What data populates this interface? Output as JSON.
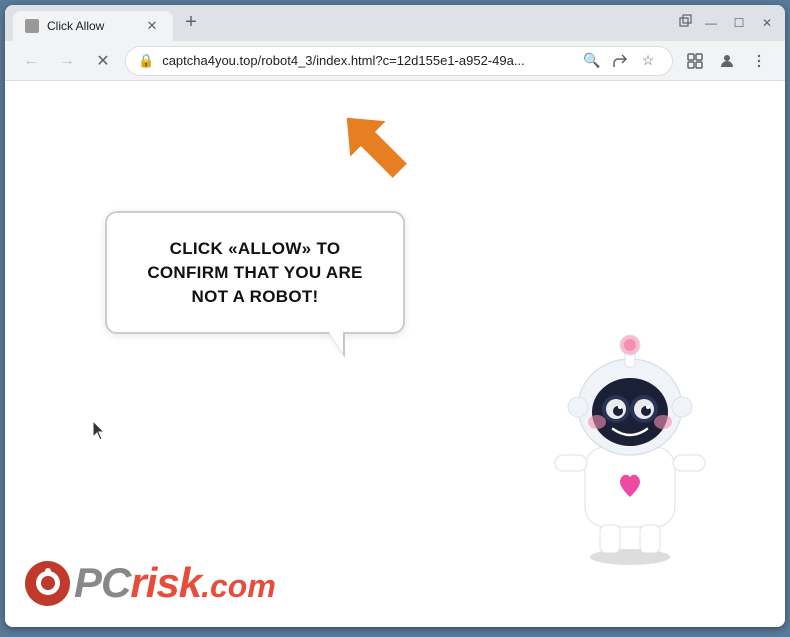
{
  "browser": {
    "tab": {
      "title": "Click Allow",
      "favicon_label": "tab-icon"
    },
    "new_tab_label": "+",
    "window_controls": {
      "minimize": "—",
      "maximize": "☐",
      "close": "✕"
    },
    "nav": {
      "back_label": "←",
      "forward_label": "→",
      "reload_label": "✕"
    },
    "url": "captcha4you.top/robot4_3/index.html?c=12d155e1-a952-49a...",
    "url_actions": {
      "search": "🔍",
      "share": "⎙",
      "bookmark": "☆"
    },
    "toolbar": {
      "extensions": "⬚",
      "profile": "👤",
      "menu": "⋮"
    }
  },
  "page": {
    "bubble_text": "CLICK «ALLOW» TO CONFIRM THAT YOU ARE NOT A ROBOT!",
    "arrow_direction": "up-right",
    "pcrisk": {
      "brand": "PC",
      "separator": "risk",
      "domain": ".com"
    }
  }
}
